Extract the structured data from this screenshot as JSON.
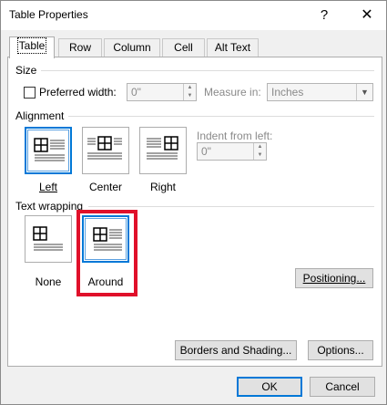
{
  "window": {
    "title": "Table Properties",
    "help_label": "?",
    "close_label": "✕"
  },
  "tabs": [
    {
      "label": "Table",
      "active": true
    },
    {
      "label": "Row",
      "active": false
    },
    {
      "label": "Column",
      "active": false
    },
    {
      "label": "Cell",
      "active": false
    },
    {
      "label": "Alt Text",
      "active": false
    }
  ],
  "size": {
    "group_label": "Size",
    "preferred_width_label": "Preferred width:",
    "preferred_width_checked": false,
    "preferred_width_value": "0\"",
    "measure_in_label": "Measure in:",
    "measure_in_value": "Inches"
  },
  "alignment": {
    "group_label": "Alignment",
    "options": [
      {
        "label": "Left",
        "selected": true
      },
      {
        "label": "Center",
        "selected": false
      },
      {
        "label": "Right",
        "selected": false
      }
    ],
    "indent_label": "Indent from left:",
    "indent_value": "0\""
  },
  "text_wrapping": {
    "group_label": "Text wrapping",
    "options": [
      {
        "label": "None",
        "selected": false
      },
      {
        "label": "Around",
        "selected": true
      }
    ],
    "positioning_label": "Positioning..."
  },
  "buttons": {
    "borders_shading": "Borders and Shading...",
    "options": "Options...",
    "ok": "OK",
    "cancel": "Cancel"
  },
  "colors": {
    "selection_blue": "#0078d7",
    "highlight_red": "#e0102a"
  }
}
